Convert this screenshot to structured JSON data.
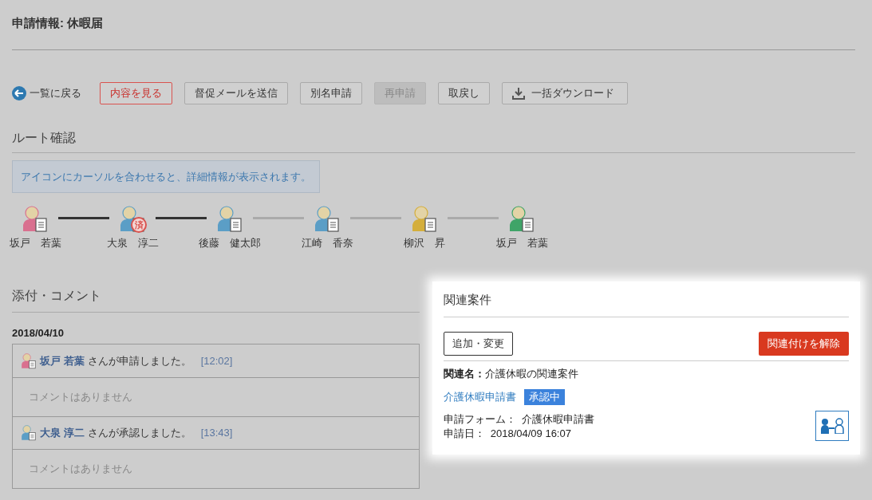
{
  "title": "申請情報: 休暇届",
  "actions": [
    {
      "kind": "back",
      "label": "一覧に戻る"
    },
    {
      "kind": "accent",
      "label": "内容を見る"
    },
    {
      "kind": "plain",
      "label": "督促メールを送信",
      "disabled": false
    },
    {
      "kind": "plain",
      "label": "別名申請",
      "disabled": false
    },
    {
      "kind": "plain",
      "label": "再申請",
      "disabled": true
    },
    {
      "kind": "plain",
      "label": "取戻し",
      "disabled": false
    },
    {
      "kind": "download",
      "label": "一括ダウンロード"
    }
  ],
  "route": {
    "heading": "ルート確認",
    "hint": "アイコンにカーソルを合わせると、詳細情報が表示されます。",
    "steps": [
      {
        "name": "坂戸　若葉",
        "color": "#d9708f"
      },
      {
        "name": "大泉　淳二",
        "color": "#5b9ec6",
        "stamp": "済"
      },
      {
        "name": "後藤　健太郎",
        "color": "#5b9ec6"
      },
      {
        "name": "江崎　香奈",
        "color": "#5b9ec6"
      },
      {
        "name": "柳沢　昇",
        "color": "#d4ae3c"
      },
      {
        "name": "坂戸　若葉",
        "color": "#3fa468"
      }
    ],
    "connectors": [
      {
        "done": true
      },
      {
        "done": true
      },
      {
        "done": false
      },
      {
        "done": false
      },
      {
        "done": false
      }
    ]
  },
  "comments": {
    "heading": "添付・コメント",
    "date": "2018/04/10",
    "entries": [
      {
        "color": "#d9708f",
        "name": "坂戸 若葉",
        "action": "さんが申請しました。",
        "time": "[12:02]",
        "comment": "コメントはありません"
      },
      {
        "color": "#5b9ec6",
        "name": "大泉 淳二",
        "action": "さんが承認しました。",
        "time": "[13:43]",
        "comment": "コメントはありません"
      }
    ]
  },
  "related": {
    "heading": "関連案件",
    "add_button": "追加・変更",
    "remove_button": "関連付けを解除",
    "name_label": "関連名：",
    "name_value": "介護休暇の関連案件",
    "link": "介護休暇申請書",
    "status": "承認中",
    "form_line": "申請フォーム：  介護休暇申請書",
    "date_line": "申請日：  2018/04/09 16:07"
  }
}
